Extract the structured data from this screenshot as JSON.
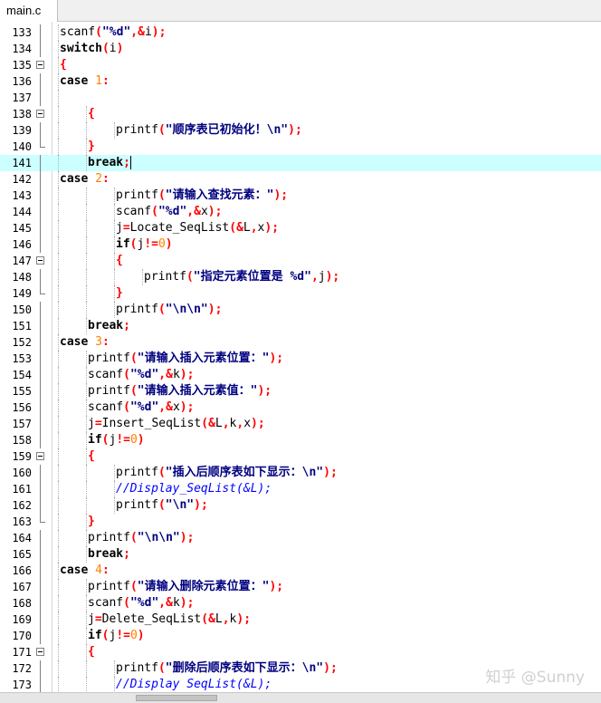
{
  "tab": {
    "label": "main.c"
  },
  "editor": {
    "current_line": "141",
    "lines": [
      {
        "num": "133",
        "indent": 2,
        "fold": "line",
        "tokens": [
          [
            "id",
            "scanf"
          ],
          [
            "op",
            "("
          ],
          [
            "str",
            "\"%d\""
          ],
          [
            "op",
            ","
          ],
          [
            "op",
            "&"
          ],
          [
            "id",
            "i"
          ],
          [
            "op",
            ")"
          ],
          [
            "op",
            ";"
          ]
        ]
      },
      {
        "num": "134",
        "indent": 2,
        "fold": "line",
        "tokens": [
          [
            "kw",
            "switch"
          ],
          [
            "op",
            "("
          ],
          [
            "id",
            "i"
          ],
          [
            "op",
            ")"
          ]
        ]
      },
      {
        "num": "135",
        "indent": 2,
        "fold": "box",
        "tokens": [
          [
            "op",
            "{"
          ]
        ]
      },
      {
        "num": "136",
        "indent": 2,
        "fold": "line",
        "tokens": [
          [
            "kw",
            "case"
          ],
          [
            "id",
            " "
          ],
          [
            "num",
            "1"
          ],
          [
            "op",
            ":"
          ]
        ]
      },
      {
        "num": "137",
        "indent": 2,
        "fold": "line",
        "tokens": []
      },
      {
        "num": "138",
        "indent": 3,
        "fold": "box",
        "tokens": [
          [
            "op",
            "{"
          ]
        ]
      },
      {
        "num": "139",
        "indent": 4,
        "fold": "line",
        "tokens": [
          [
            "id",
            "printf"
          ],
          [
            "op",
            "("
          ],
          [
            "str",
            "\"顺序表已初始化！\\n\""
          ],
          [
            "op",
            ")"
          ],
          [
            "op",
            ";"
          ]
        ]
      },
      {
        "num": "140",
        "indent": 3,
        "fold": "end",
        "tokens": [
          [
            "op",
            "}"
          ]
        ]
      },
      {
        "num": "141",
        "indent": 3,
        "fold": "line",
        "caret": true,
        "tokens": [
          [
            "kw",
            "break"
          ],
          [
            "op",
            ";"
          ]
        ]
      },
      {
        "num": "142",
        "indent": 2,
        "fold": "line",
        "tokens": [
          [
            "kw",
            "case"
          ],
          [
            "id",
            " "
          ],
          [
            "num",
            "2"
          ],
          [
            "op",
            ":"
          ]
        ]
      },
      {
        "num": "143",
        "indent": 4,
        "fold": "line",
        "tokens": [
          [
            "id",
            "printf"
          ],
          [
            "op",
            "("
          ],
          [
            "str",
            "\"请输入查找元素：\""
          ],
          [
            "op",
            ")"
          ],
          [
            "op",
            ";"
          ]
        ]
      },
      {
        "num": "144",
        "indent": 4,
        "fold": "line",
        "tokens": [
          [
            "id",
            "scanf"
          ],
          [
            "op",
            "("
          ],
          [
            "str",
            "\"%d\""
          ],
          [
            "op",
            ","
          ],
          [
            "op",
            "&"
          ],
          [
            "id",
            "x"
          ],
          [
            "op",
            ")"
          ],
          [
            "op",
            ";"
          ]
        ]
      },
      {
        "num": "145",
        "indent": 4,
        "fold": "line",
        "tokens": [
          [
            "id",
            "j"
          ],
          [
            "op",
            "="
          ],
          [
            "id",
            "Locate_SeqList"
          ],
          [
            "op",
            "("
          ],
          [
            "op",
            "&"
          ],
          [
            "id",
            "L"
          ],
          [
            "op",
            ","
          ],
          [
            "id",
            "x"
          ],
          [
            "op",
            ")"
          ],
          [
            "op",
            ";"
          ]
        ]
      },
      {
        "num": "146",
        "indent": 4,
        "fold": "line",
        "tokens": [
          [
            "kw",
            "if"
          ],
          [
            "op",
            "("
          ],
          [
            "id",
            "j"
          ],
          [
            "op",
            "!="
          ],
          [
            "num",
            "0"
          ],
          [
            "op",
            ")"
          ]
        ]
      },
      {
        "num": "147",
        "indent": 4,
        "fold": "box",
        "tokens": [
          [
            "op",
            "{"
          ]
        ]
      },
      {
        "num": "148",
        "indent": 5,
        "fold": "line",
        "tokens": [
          [
            "id",
            "printf"
          ],
          [
            "op",
            "("
          ],
          [
            "str",
            "\"指定元素位置是 %d\""
          ],
          [
            "op",
            ","
          ],
          [
            "id",
            "j"
          ],
          [
            "op",
            ")"
          ],
          [
            "op",
            ";"
          ]
        ]
      },
      {
        "num": "149",
        "indent": 4,
        "fold": "end",
        "tokens": [
          [
            "op",
            "}"
          ]
        ]
      },
      {
        "num": "150",
        "indent": 4,
        "fold": "line",
        "tokens": [
          [
            "id",
            "printf"
          ],
          [
            "op",
            "("
          ],
          [
            "str",
            "\"\\n\\n\""
          ],
          [
            "op",
            ")"
          ],
          [
            "op",
            ";"
          ]
        ]
      },
      {
        "num": "151",
        "indent": 3,
        "fold": "line",
        "tokens": [
          [
            "kw",
            "break"
          ],
          [
            "op",
            ";"
          ]
        ]
      },
      {
        "num": "152",
        "indent": 2,
        "fold": "line",
        "tokens": [
          [
            "kw",
            "case"
          ],
          [
            "id",
            " "
          ],
          [
            "num",
            "3"
          ],
          [
            "op",
            ":"
          ]
        ]
      },
      {
        "num": "153",
        "indent": 3,
        "fold": "line",
        "tokens": [
          [
            "id",
            "printf"
          ],
          [
            "op",
            "("
          ],
          [
            "str",
            "\"请输入插入元素位置：\""
          ],
          [
            "op",
            ")"
          ],
          [
            "op",
            ";"
          ]
        ]
      },
      {
        "num": "154",
        "indent": 3,
        "fold": "line",
        "tokens": [
          [
            "id",
            "scanf"
          ],
          [
            "op",
            "("
          ],
          [
            "str",
            "\"%d\""
          ],
          [
            "op",
            ","
          ],
          [
            "op",
            "&"
          ],
          [
            "id",
            "k"
          ],
          [
            "op",
            ")"
          ],
          [
            "op",
            ";"
          ]
        ]
      },
      {
        "num": "155",
        "indent": 3,
        "fold": "line",
        "tokens": [
          [
            "id",
            "printf"
          ],
          [
            "op",
            "("
          ],
          [
            "str",
            "\"请输入插入元素值：\""
          ],
          [
            "op",
            ")"
          ],
          [
            "op",
            ";"
          ]
        ]
      },
      {
        "num": "156",
        "indent": 3,
        "fold": "line",
        "tokens": [
          [
            "id",
            "scanf"
          ],
          [
            "op",
            "("
          ],
          [
            "str",
            "\"%d\""
          ],
          [
            "op",
            ","
          ],
          [
            "op",
            "&"
          ],
          [
            "id",
            "x"
          ],
          [
            "op",
            ")"
          ],
          [
            "op",
            ";"
          ]
        ]
      },
      {
        "num": "157",
        "indent": 3,
        "fold": "line",
        "tokens": [
          [
            "id",
            "j"
          ],
          [
            "op",
            "="
          ],
          [
            "id",
            "Insert_SeqList"
          ],
          [
            "op",
            "("
          ],
          [
            "op",
            "&"
          ],
          [
            "id",
            "L"
          ],
          [
            "op",
            ","
          ],
          [
            "id",
            "k"
          ],
          [
            "op",
            ","
          ],
          [
            "id",
            "x"
          ],
          [
            "op",
            ")"
          ],
          [
            "op",
            ";"
          ]
        ]
      },
      {
        "num": "158",
        "indent": 3,
        "fold": "line",
        "tokens": [
          [
            "kw",
            "if"
          ],
          [
            "op",
            "("
          ],
          [
            "id",
            "j"
          ],
          [
            "op",
            "!="
          ],
          [
            "num",
            "0"
          ],
          [
            "op",
            ")"
          ]
        ]
      },
      {
        "num": "159",
        "indent": 3,
        "fold": "box",
        "tokens": [
          [
            "op",
            "{"
          ]
        ]
      },
      {
        "num": "160",
        "indent": 4,
        "fold": "line",
        "tokens": [
          [
            "id",
            "printf"
          ],
          [
            "op",
            "("
          ],
          [
            "str",
            "\"插入后顺序表如下显示：\\n\""
          ],
          [
            "op",
            ")"
          ],
          [
            "op",
            ";"
          ]
        ]
      },
      {
        "num": "161",
        "indent": 4,
        "fold": "line",
        "tokens": [
          [
            "cmt",
            "//Display_SeqList(&L);"
          ]
        ]
      },
      {
        "num": "162",
        "indent": 4,
        "fold": "line",
        "tokens": [
          [
            "id",
            "printf"
          ],
          [
            "op",
            "("
          ],
          [
            "str",
            "\"\\n\""
          ],
          [
            "op",
            ")"
          ],
          [
            "op",
            ";"
          ]
        ]
      },
      {
        "num": "163",
        "indent": 3,
        "fold": "end",
        "tokens": [
          [
            "op",
            "}"
          ]
        ]
      },
      {
        "num": "164",
        "indent": 3,
        "fold": "line",
        "tokens": [
          [
            "id",
            "printf"
          ],
          [
            "op",
            "("
          ],
          [
            "str",
            "\"\\n\\n\""
          ],
          [
            "op",
            ")"
          ],
          [
            "op",
            ";"
          ]
        ]
      },
      {
        "num": "165",
        "indent": 3,
        "fold": "line",
        "tokens": [
          [
            "kw",
            "break"
          ],
          [
            "op",
            ";"
          ]
        ]
      },
      {
        "num": "166",
        "indent": 2,
        "fold": "line",
        "tokens": [
          [
            "kw",
            "case"
          ],
          [
            "id",
            " "
          ],
          [
            "num",
            "4"
          ],
          [
            "op",
            ":"
          ]
        ]
      },
      {
        "num": "167",
        "indent": 3,
        "fold": "line",
        "tokens": [
          [
            "id",
            "printf"
          ],
          [
            "op",
            "("
          ],
          [
            "str",
            "\"请输入删除元素位置：\""
          ],
          [
            "op",
            ")"
          ],
          [
            "op",
            ";"
          ]
        ]
      },
      {
        "num": "168",
        "indent": 3,
        "fold": "line",
        "tokens": [
          [
            "id",
            "scanf"
          ],
          [
            "op",
            "("
          ],
          [
            "str",
            "\"%d\""
          ],
          [
            "op",
            ","
          ],
          [
            "op",
            "&"
          ],
          [
            "id",
            "k"
          ],
          [
            "op",
            ")"
          ],
          [
            "op",
            ";"
          ]
        ]
      },
      {
        "num": "169",
        "indent": 3,
        "fold": "line",
        "tokens": [
          [
            "id",
            "j"
          ],
          [
            "op",
            "="
          ],
          [
            "id",
            "Delete_SeqList"
          ],
          [
            "op",
            "("
          ],
          [
            "op",
            "&"
          ],
          [
            "id",
            "L"
          ],
          [
            "op",
            ","
          ],
          [
            "id",
            "k"
          ],
          [
            "op",
            ")"
          ],
          [
            "op",
            ";"
          ]
        ]
      },
      {
        "num": "170",
        "indent": 3,
        "fold": "line",
        "tokens": [
          [
            "kw",
            "if"
          ],
          [
            "op",
            "("
          ],
          [
            "id",
            "j"
          ],
          [
            "op",
            "!="
          ],
          [
            "num",
            "0"
          ],
          [
            "op",
            ")"
          ]
        ]
      },
      {
        "num": "171",
        "indent": 3,
        "fold": "box",
        "tokens": [
          [
            "op",
            "{"
          ]
        ]
      },
      {
        "num": "172",
        "indent": 4,
        "fold": "line",
        "tokens": [
          [
            "id",
            "printf"
          ],
          [
            "op",
            "("
          ],
          [
            "str",
            "\"删除后顺序表如下显示：\\n\""
          ],
          [
            "op",
            ")"
          ],
          [
            "op",
            ";"
          ]
        ]
      },
      {
        "num": "173",
        "indent": 4,
        "fold": "line",
        "tokens": [
          [
            "cmt",
            "//Display SeqList(&L);"
          ]
        ]
      }
    ]
  },
  "watermark": {
    "text": "知乎 @Sunny"
  },
  "colors": {
    "current_line": "#ccffff",
    "string": "#000080",
    "operator": "#ff0000",
    "number": "#ff8000",
    "comment": "#0000ff"
  }
}
